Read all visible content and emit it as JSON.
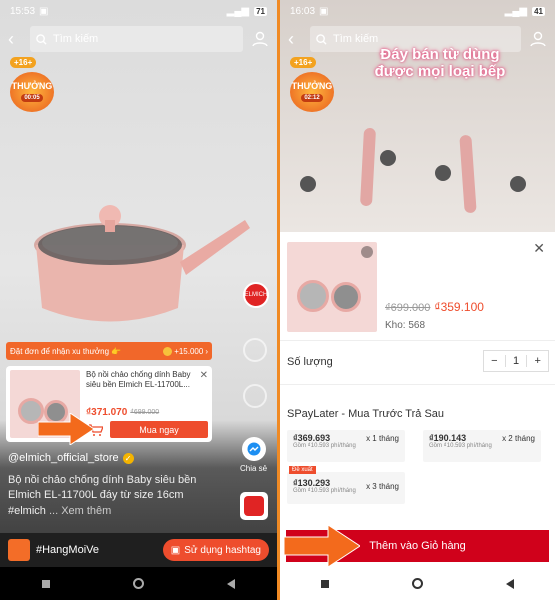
{
  "left": {
    "status": {
      "time": "15:53",
      "battery": "71"
    },
    "search": {
      "placeholder": "Tìm kiếm"
    },
    "badge": {
      "coins": "+16+",
      "title": "THƯỞNG",
      "timer": "00:05"
    },
    "promo": {
      "text": "Đặt đơn để nhận xu thưởng 👉",
      "coins": "+15.000"
    },
    "product": {
      "title": "Bộ nồi chảo chống dính Baby siêu bền Elmich EL-11700L...",
      "price": "₫371.070",
      "old_price": "₫699.000",
      "buy_label": "Mua ngay"
    },
    "shop": "@elmich_official_store",
    "description": "Bộ nồi chảo chống dính Baby  siêu bền Elmich EL-11700L đáy từ  size 16cm #elmich",
    "more": "... Xem thêm",
    "share_label": "Chia sẻ",
    "hashtag": "#HangMoiVe",
    "use_hashtag": "Sử dụng hashtag"
  },
  "right": {
    "status": {
      "time": "16:03",
      "battery": "41"
    },
    "search": {
      "placeholder": "Tìm kiếm"
    },
    "badge": {
      "coins": "+16+",
      "title": "THƯỞNG",
      "timer": "02:12"
    },
    "hero_text": "Đáy bán từ dùng được mọi loại bếp",
    "sheet": {
      "old_price": "₫699.000",
      "price": "₫359.100",
      "stock": "Kho: 568",
      "qty_label": "Số lượng",
      "qty": "1",
      "spay_title": "SPayLater - Mua Trước Trả Sau",
      "plans": [
        {
          "amount": "₫369.693",
          "months": "x 1 tháng",
          "fee": "Gồm ₫10.593 phí/tháng"
        },
        {
          "amount": "₫190.143",
          "months": "x 2 tháng",
          "fee": "Gồm ₫10.593 phí/tháng"
        },
        {
          "amount": "₫130.293",
          "months": "x 3 tháng",
          "fee": "Gồm ₫10.593 phí/tháng",
          "tag": "Đề xuất"
        }
      ],
      "add_cart": "Thêm vào Giỏ hàng"
    }
  },
  "colors": {
    "accent": "#ee4d2d",
    "divider": "#f08a24",
    "add_cart": "#d0011b",
    "arrow": "#f36a1c"
  }
}
